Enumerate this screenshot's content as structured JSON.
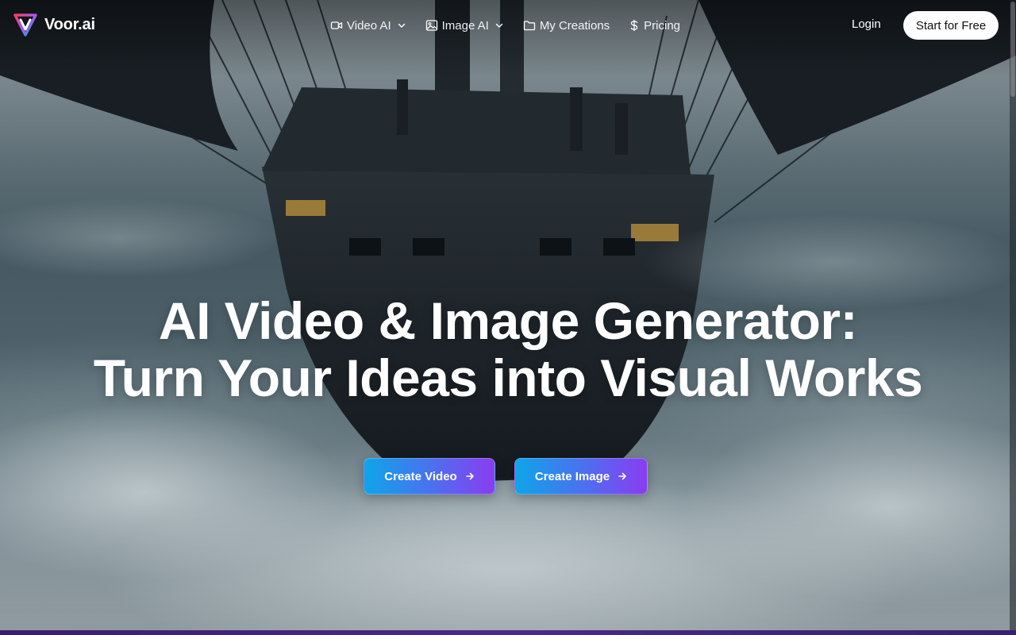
{
  "brand": {
    "name": "Voor.ai",
    "logo_icon": "voor-logo-icon",
    "logo_colors": [
      "#f43f5e",
      "#a855f7",
      "#06b6d4"
    ]
  },
  "nav": {
    "items": [
      {
        "label": "Video AI",
        "icon": "video-camera-icon",
        "has_dropdown": true
      },
      {
        "label": "Image AI",
        "icon": "image-icon",
        "has_dropdown": true
      },
      {
        "label": "My Creations",
        "icon": "folder-icon",
        "has_dropdown": false
      },
      {
        "label": "Pricing",
        "icon": "dollar-icon",
        "has_dropdown": false
      }
    ],
    "login_label": "Login",
    "start_label": "Start for Free"
  },
  "hero": {
    "title_line1": "AI Video & Image Generator:",
    "title_line2": "Turn Your Ideas into Visual Works",
    "cta_video_label": "Create Video",
    "cta_image_label": "Create Image",
    "cta_icon": "arrow-right-icon"
  },
  "colors": {
    "cta_gradient_start": "#0ea5e9",
    "cta_gradient_end": "#8b3cf0",
    "start_button_bg": "#ffffff"
  }
}
